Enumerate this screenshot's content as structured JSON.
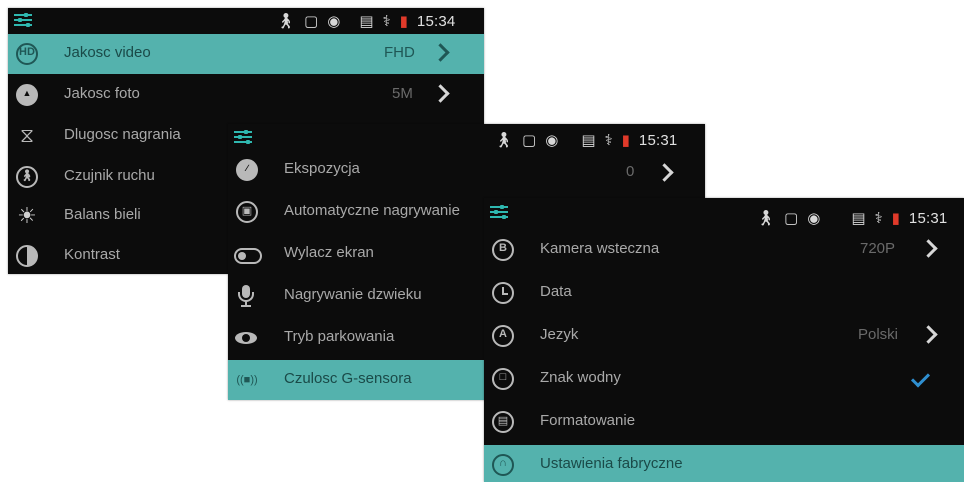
{
  "accent_color": "#54b2ad",
  "screen1": {
    "status": {
      "time": "15:34"
    },
    "items": [
      {
        "label": "Jakosc video",
        "value": "FHD",
        "icon": "hd-icon",
        "selected": true
      },
      {
        "label": "Jakosc foto",
        "value": "5M",
        "icon": "photo-icon"
      },
      {
        "label": "Dlugosc nagrania",
        "icon": "hourglass-icon"
      },
      {
        "label": "Czujnik ruchu",
        "icon": "motion-sensor-icon"
      },
      {
        "label": "Balans bieli",
        "icon": "sun-icon"
      },
      {
        "label": "Kontrast",
        "icon": "contrast-icon"
      }
    ]
  },
  "screen2": {
    "status": {
      "time": "15:31",
      "partial_value": "0"
    },
    "items": [
      {
        "label": "Ekspozycja",
        "icon": "exposure-icon"
      },
      {
        "label": "Automatyczne nagrywanie",
        "icon": "lock-icon"
      },
      {
        "label": "Wylacz ekran",
        "icon": "toggle-icon"
      },
      {
        "label": "Nagrywanie dzwieku",
        "icon": "microphone-icon"
      },
      {
        "label": "Tryb parkowania",
        "icon": "eye-icon"
      },
      {
        "label": "Czulosc G-sensora",
        "icon": "g-sensor-icon",
        "selected": true
      }
    ]
  },
  "screen3": {
    "status": {
      "time": "15:31"
    },
    "items": [
      {
        "label": "Kamera wsteczna",
        "value": "720P",
        "icon": "rear-camera-icon"
      },
      {
        "label": "Data",
        "icon": "clock-icon"
      },
      {
        "label": "Jezyk",
        "value": "Polski",
        "icon": "language-icon"
      },
      {
        "label": "Znak wodny",
        "icon": "watermark-icon",
        "checked": true
      },
      {
        "label": "Formatowanie",
        "icon": "format-icon"
      },
      {
        "label": "Ustawienia fabryczne",
        "icon": "factory-reset-icon",
        "selected": true
      }
    ]
  }
}
